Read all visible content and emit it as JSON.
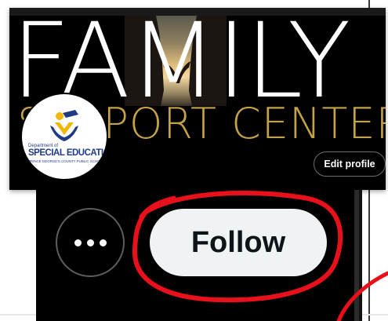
{
  "banner": {
    "title": "FAMILY",
    "subtitle": "SUPPORT CENTER"
  },
  "avatar": {
    "dept_line": "Department of",
    "name_line": "SPECIAL EDUCATION",
    "org_line": "PRINCE GEORGE'S COUNTY PUBLIC SCHOOLS"
  },
  "actions": {
    "edit_profile_label": "Edit profile",
    "follow_label": "Follow",
    "more_icon": "more-horizontal-icon"
  },
  "colors": {
    "annotation": "#e8101a",
    "gold": "#c4a247",
    "follow_bg": "#eff3f4"
  }
}
